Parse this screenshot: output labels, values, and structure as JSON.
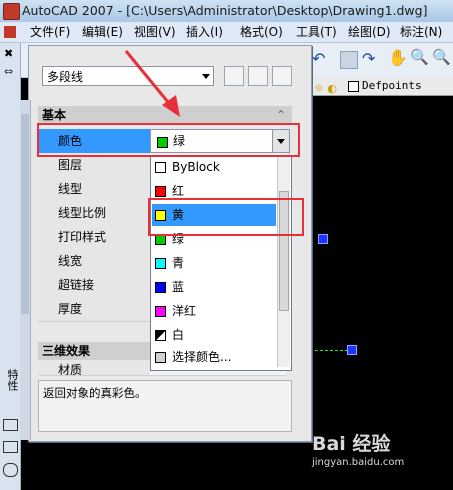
{
  "window": {
    "title": "AutoCAD 2007 - [C:\\Users\\Administrator\\Desktop\\Drawing1.dwg]"
  },
  "menu": [
    "文件(F)",
    "编辑(E)",
    "视图(V)",
    "插入(I)",
    "格式(O)",
    "工具(T)",
    "绘图(D)",
    "标注(N)"
  ],
  "layer_bar": {
    "layer_name": "Defpoints"
  },
  "properties": {
    "object_type": "多段线",
    "section_basic": "基本",
    "rows": [
      "颜色",
      "图层",
      "线型",
      "线型比例",
      "打印样式",
      "线宽",
      "超链接",
      "厚度"
    ],
    "color_value": "绿",
    "section_3d": "三维效果",
    "row_material": "材质",
    "description": "返回对象的真彩色。",
    "side_tab_label": "特性"
  },
  "color_dropdown": {
    "items": [
      {
        "label": "ByBlock",
        "color": "#ffffff"
      },
      {
        "label": "红",
        "color": "#ff0000"
      },
      {
        "label": "黄",
        "color": "#ffff00"
      },
      {
        "label": "绿",
        "color": "#00cc00"
      },
      {
        "label": "青",
        "color": "#00ffff"
      },
      {
        "label": "蓝",
        "color": "#0000ff"
      },
      {
        "label": "洋红",
        "color": "#ff00ff"
      },
      {
        "label": "白",
        "color": "#000000"
      },
      {
        "label": "选择颜色...",
        "color": "#d0d0d0"
      }
    ],
    "highlighted": "黄"
  },
  "watermark": {
    "brand": "Bai 经验",
    "url": "jingyan.baidu.com"
  }
}
